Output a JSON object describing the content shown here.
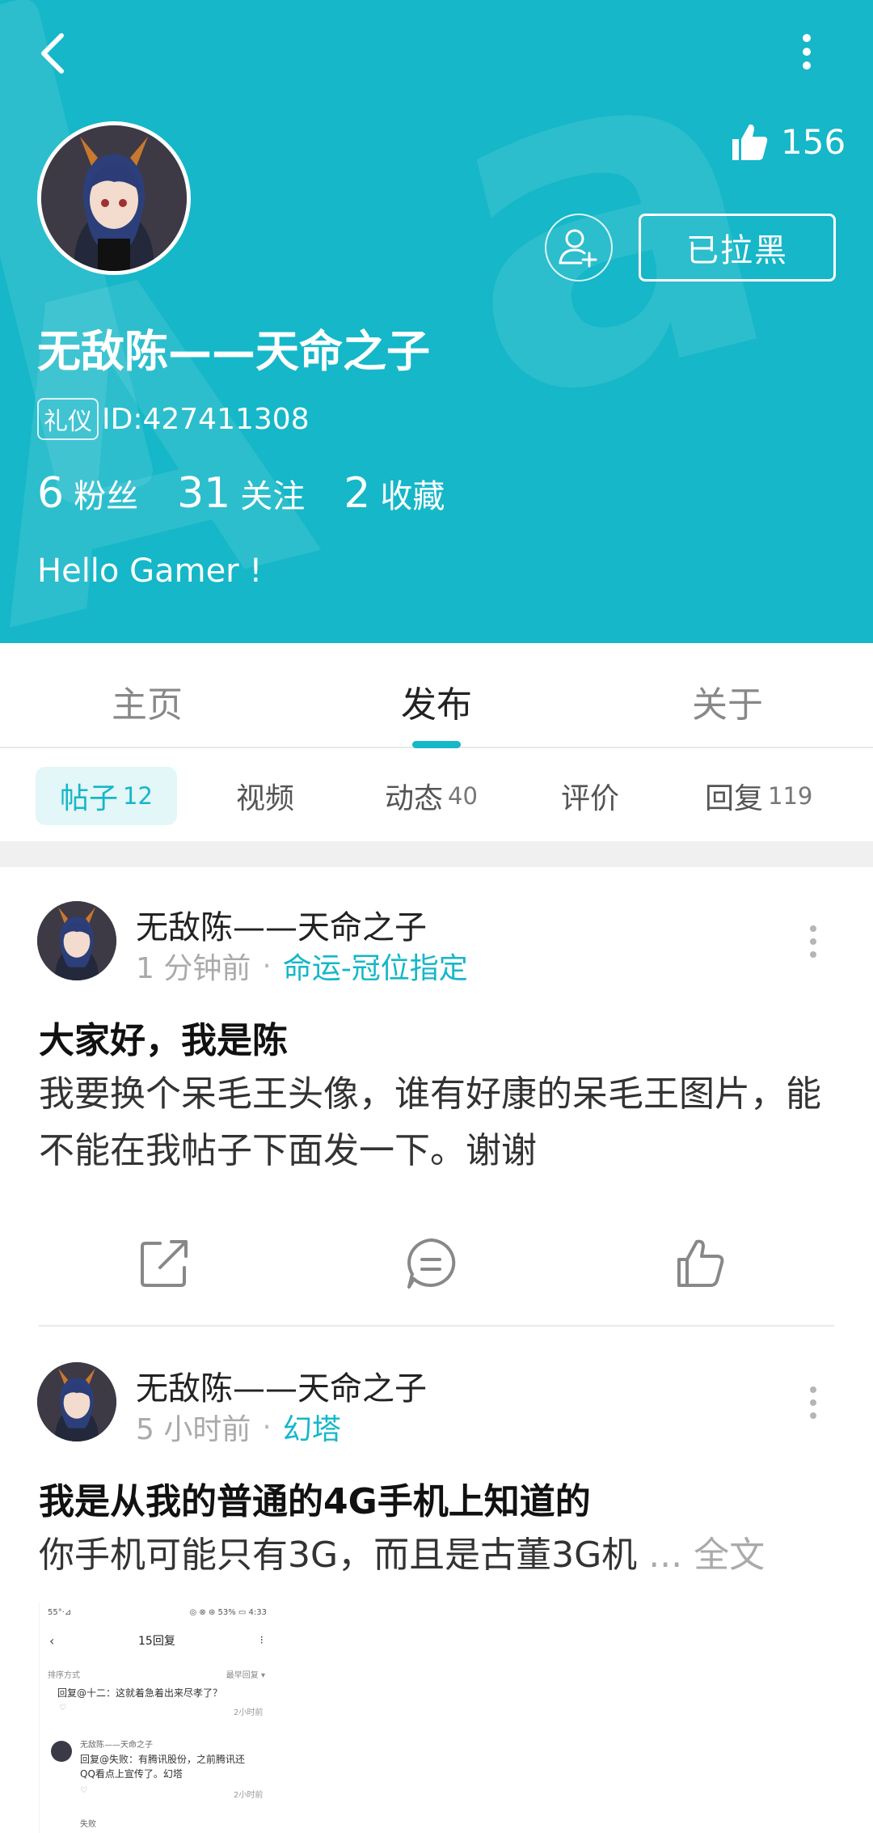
{
  "header": {
    "likes_count": "156",
    "blocked_label": "已拉黑",
    "username": "无敌陈——天命之子",
    "badge": "礼仪",
    "user_id": "ID:427411308",
    "stats": [
      {
        "num": "6",
        "label": "粉丝"
      },
      {
        "num": "31",
        "label": "关注"
      },
      {
        "num": "2",
        "label": "收藏"
      }
    ],
    "bio": "Hello Gamer !",
    "bg_color": "#15b7c8"
  },
  "tabs": [
    {
      "label": "主页"
    },
    {
      "label": "发布",
      "active": true
    },
    {
      "label": "关于"
    }
  ],
  "subtabs": [
    {
      "label": "帖子",
      "count": "12",
      "active": true
    },
    {
      "label": "视频",
      "count": ""
    },
    {
      "label": "动态",
      "count": "40"
    },
    {
      "label": "评价",
      "count": ""
    },
    {
      "label": "回复",
      "count": "119"
    }
  ],
  "posts": [
    {
      "author": "无敌陈——天命之子",
      "time": "1 分钟前",
      "topic": "命运-冠位指定",
      "title": "大家好，我是陈",
      "body": "我要换个呆毛王头像，谁有好康的呆毛王图片，能不能在我帖子下面发一下。谢谢"
    },
    {
      "author": "无敌陈——天命之子",
      "time": "5 小时前",
      "topic": "幻塔",
      "title": "我是从我的普通的4G手机上知道的",
      "body": "你手机可能只有3G，而且是古董3G机",
      "ellipsis": "...",
      "read_more": "全文"
    }
  ],
  "thumbnail": {
    "status_left": "55°·⊿",
    "status_right": "◎ ⊗ ⊛ 53% ▭ 4:33",
    "back": "‹",
    "title": "15回复",
    "menu": "⁝",
    "sort_label": "排序方式",
    "sort_value": "最早回复 ▾",
    "reply1": "回复@十二：这就着急着出来尽孝了？",
    "reply1_time": "2小时前",
    "author2": "无敌陈——天命之子",
    "reply2a": "回复@失败：有腾讯股份，之前腾讯还",
    "reply2b": "QQ看点上宣传了。幻塔",
    "reply2_time": "2小时前",
    "author3": "失败"
  },
  "accent_color": "#15b7c8"
}
